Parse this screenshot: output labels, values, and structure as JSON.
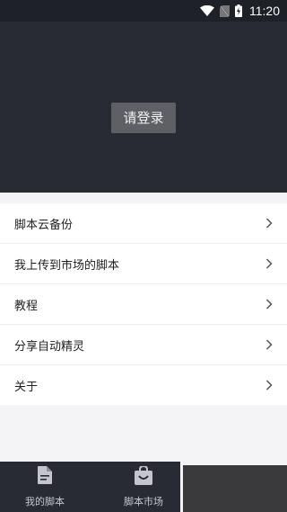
{
  "status_bar": {
    "time": "11:20",
    "icons": [
      "wifi-icon",
      "no-sim-icon",
      "battery-charging-icon"
    ]
  },
  "header": {
    "login_label": "请登录"
  },
  "menu": {
    "items": [
      {
        "label": "脚本云备份",
        "icon": "chevron-right-icon"
      },
      {
        "label": "我上传到市场的脚本",
        "icon": "chevron-right-icon"
      },
      {
        "label": "教程",
        "icon": "chevron-right-icon"
      },
      {
        "label": "分享自动精灵",
        "icon": "chevron-right-icon"
      },
      {
        "label": "关于",
        "icon": "chevron-right-icon"
      }
    ]
  },
  "tabbar": {
    "tabs": [
      {
        "label": "我的脚本",
        "icon": "document-icon"
      },
      {
        "label": "脚本市场",
        "icon": "shopping-bag-icon"
      }
    ]
  },
  "colors": {
    "header_bg": "#292b34",
    "login_button_bg": "#5f6065",
    "page_bg": "#f4f4f7",
    "tabbar_bg": "#292b34"
  }
}
